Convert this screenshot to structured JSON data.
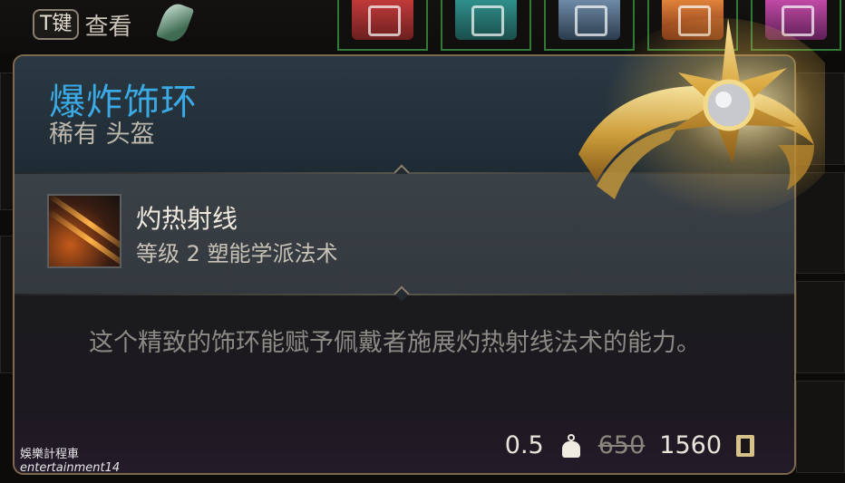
{
  "hint": {
    "key": "T键",
    "label": "查看"
  },
  "item": {
    "name": "爆炸饰环",
    "rarity_type": "稀有 头盔",
    "name_color": "#3aa9e4"
  },
  "spell": {
    "name": "灼热射线",
    "level_school": "等级 2 塑能学派法术",
    "icon": "scorching-ray-icon"
  },
  "description": "这个精致的饰环能赋予佩戴者施展灼热射线法术的能力。",
  "stats": {
    "weight": "0.5",
    "weight_icon": "weight-icon",
    "original_price": "650",
    "price": "1560",
    "currency_icon": "gold-coin-icon"
  },
  "watermark": {
    "line1": "娛樂計程車",
    "line2": "entertainment14"
  },
  "colors": {
    "border": "#7d6a4e",
    "frame_green": "#2f7a35"
  }
}
